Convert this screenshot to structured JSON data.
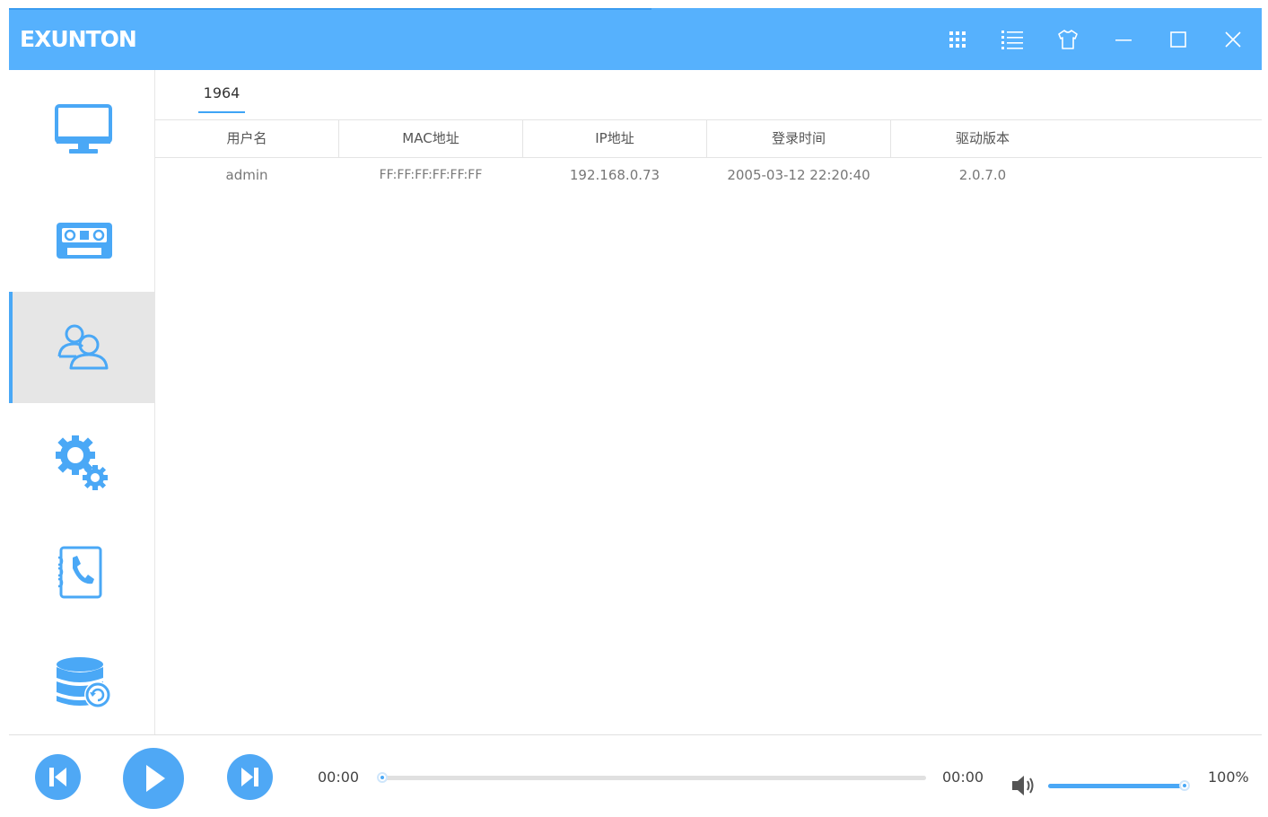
{
  "app": {
    "title": "EXUNTON",
    "accent_color": "#56b1fd",
    "titlebar_icons": [
      "apps-grid-icon",
      "list-menu-icon",
      "skin-shirt-icon",
      "minimize-icon",
      "maximize-icon",
      "close-icon"
    ]
  },
  "sidebar": {
    "items": [
      {
        "name": "monitor",
        "icon": "monitor-icon",
        "active": false
      },
      {
        "name": "cassette",
        "icon": "cassette-icon",
        "active": false
      },
      {
        "name": "users",
        "icon": "users-icon",
        "active": true
      },
      {
        "name": "settings",
        "icon": "gears-icon",
        "active": false
      },
      {
        "name": "contacts",
        "icon": "phone-book-icon",
        "active": false
      },
      {
        "name": "database",
        "icon": "database-sync-icon",
        "active": false
      }
    ]
  },
  "main": {
    "tab_label": "1964",
    "table": {
      "headers": [
        "用户名",
        "MAC地址",
        "IP地址",
        "登录时间",
        "驱动版本"
      ],
      "rows": [
        [
          "admin",
          "FF:FF:FF:FF:FF:FF",
          "192.168.0.73",
          "2005-03-12 22:20:40",
          "2.0.7.0"
        ]
      ]
    }
  },
  "player": {
    "current_time": "00:00",
    "total_time": "00:00",
    "progress": 0,
    "volume_percent": 100,
    "volume_label": "100%"
  }
}
